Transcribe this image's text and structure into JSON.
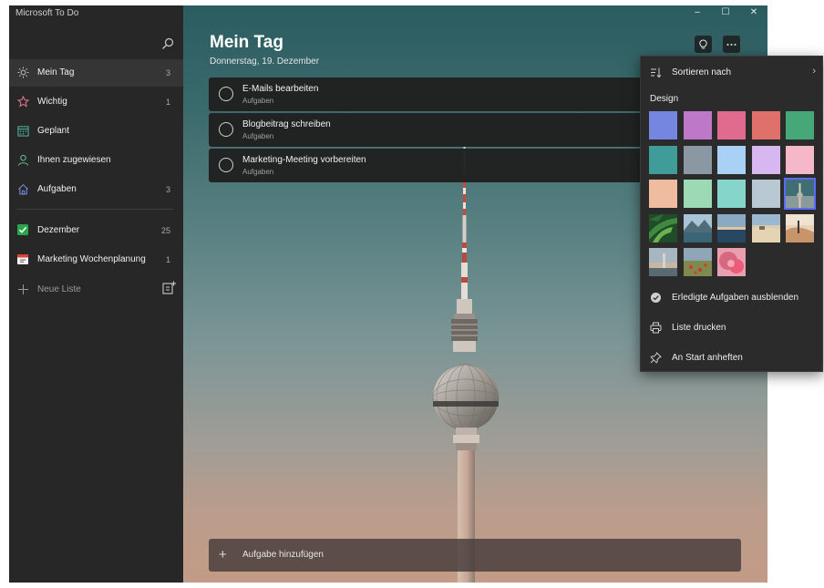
{
  "app": {
    "title": "Microsoft To Do"
  },
  "sidebar": {
    "items": [
      {
        "label": "Mein Tag",
        "count": "3",
        "icon": "sun-icon",
        "active": true
      },
      {
        "label": "Wichtig",
        "count": "1",
        "icon": "star-icon"
      },
      {
        "label": "Geplant",
        "count": "",
        "icon": "calendar-icon"
      },
      {
        "label": "Ihnen zugewiesen",
        "count": "",
        "icon": "person-icon"
      },
      {
        "label": "Aufgaben",
        "count": "3",
        "icon": "home-icon"
      }
    ],
    "lists": [
      {
        "label": "Dezember",
        "count": "25",
        "icon": "checkbox-emoji-icon"
      },
      {
        "label": "Marketing Wochenplanung",
        "count": "1",
        "icon": "calendar-emoji-icon"
      }
    ],
    "new_list_label": "Neue Liste"
  },
  "main": {
    "title": "Mein Tag",
    "subtitle": "Donnerstag, 19. Dezember",
    "tasks": [
      {
        "title": "E-Mails bearbeiten",
        "list": "Aufgaben"
      },
      {
        "title": "Blogbeitrag schreiben",
        "list": "Aufgaben"
      },
      {
        "title": "Marketing-Meeting vorbereiten",
        "list": "Aufgaben"
      }
    ],
    "add_task_label": "Aufgabe hinzufügen"
  },
  "window_controls": {
    "minimize": "–",
    "maximize": "☐",
    "close": "✕"
  },
  "menu": {
    "sort_label": "Sortieren nach",
    "design_label": "Design",
    "swatches": [
      {
        "type": "color",
        "value": "#7486e0"
      },
      {
        "type": "color",
        "value": "#bd78c7"
      },
      {
        "type": "color",
        "value": "#e06b8e"
      },
      {
        "type": "color",
        "value": "#e0706a"
      },
      {
        "type": "color",
        "value": "#46a878"
      },
      {
        "type": "color",
        "value": "#3f9c98"
      },
      {
        "type": "color",
        "value": "#8a98a3"
      },
      {
        "type": "color",
        "value": "#a9d0f5"
      },
      {
        "type": "color",
        "value": "#d6b7ef"
      },
      {
        "type": "color",
        "value": "#f4b8c8"
      },
      {
        "type": "color",
        "value": "#f0bca0"
      },
      {
        "type": "color",
        "value": "#9ed9b6"
      },
      {
        "type": "color",
        "value": "#86d5cb"
      },
      {
        "type": "color",
        "value": "#b9c9d3"
      },
      {
        "type": "image",
        "value": "tower-image",
        "selected": true
      },
      {
        "type": "image",
        "value": "palm-leaves-image"
      },
      {
        "type": "image",
        "value": "mountain-lake-image"
      },
      {
        "type": "image",
        "value": "ocean-sunset-image"
      },
      {
        "type": "image",
        "value": "beach-image"
      },
      {
        "type": "image",
        "value": "desert-dunes-image"
      },
      {
        "type": "image",
        "value": "lighthouse-image"
      },
      {
        "type": "image",
        "value": "poppy-field-image"
      },
      {
        "type": "image",
        "value": "pink-flower-image"
      }
    ],
    "items": [
      {
        "label": "Erledigte Aufgaben ausblenden",
        "icon": "check-circle-icon"
      },
      {
        "label": "Liste drucken",
        "icon": "printer-icon"
      },
      {
        "label": "An Start anheften",
        "icon": "pin-icon"
      }
    ]
  },
  "colors": {
    "accent": "#5a6cff",
    "sidebar_bg": "#272727",
    "menu_bg": "#2b2b2b",
    "task_bg": "#202020"
  }
}
